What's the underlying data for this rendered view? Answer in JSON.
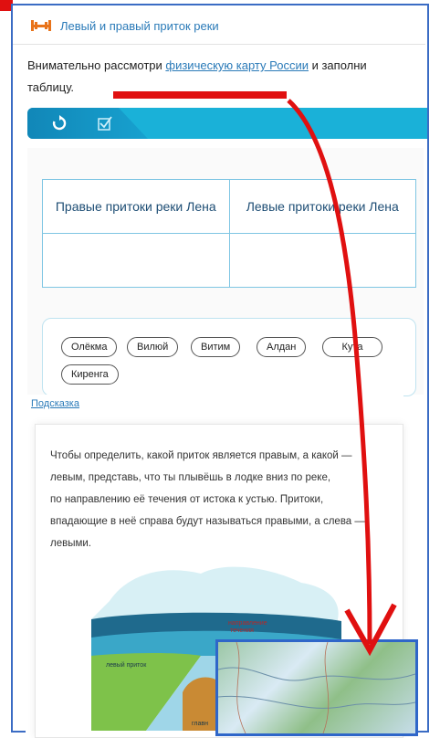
{
  "header": {
    "title": "Левый и правый приток реки"
  },
  "instruction": {
    "before": "Внимательно рассмотри ",
    "link": "физическую карту России",
    "after": " и заполни таблицу."
  },
  "toolbar": {
    "refresh_icon": "refresh-icon",
    "check_icon": "checkbox-icon"
  },
  "table": {
    "headers": [
      "Правые притоки реки Лена",
      "Левые притоки реки Лена"
    ]
  },
  "chips": [
    "Олёкма",
    "Вилюй",
    "Витим",
    "Алдан",
    "Кута",
    "Киренга"
  ],
  "hint": {
    "link": "Подсказка",
    "lines": [
      "Чтобы определить, какой приток является правым, а какой —",
      "левым, представь, что ты плывёшь в лодке вниз по реке,",
      "по направлению её течения от истока к устью. Притоки,",
      "впадающие в неё справа будут называться правыми, а слева —",
      "левыми."
    ]
  },
  "illustration": {
    "label_direction_1": "направление",
    "label_direction_2": "течения",
    "label_left_tributary": "левый приток",
    "label_main": "главн"
  },
  "colors": {
    "accent": "#1ab1d8",
    "link": "#2a7ab8",
    "annotation": "#e01010"
  }
}
